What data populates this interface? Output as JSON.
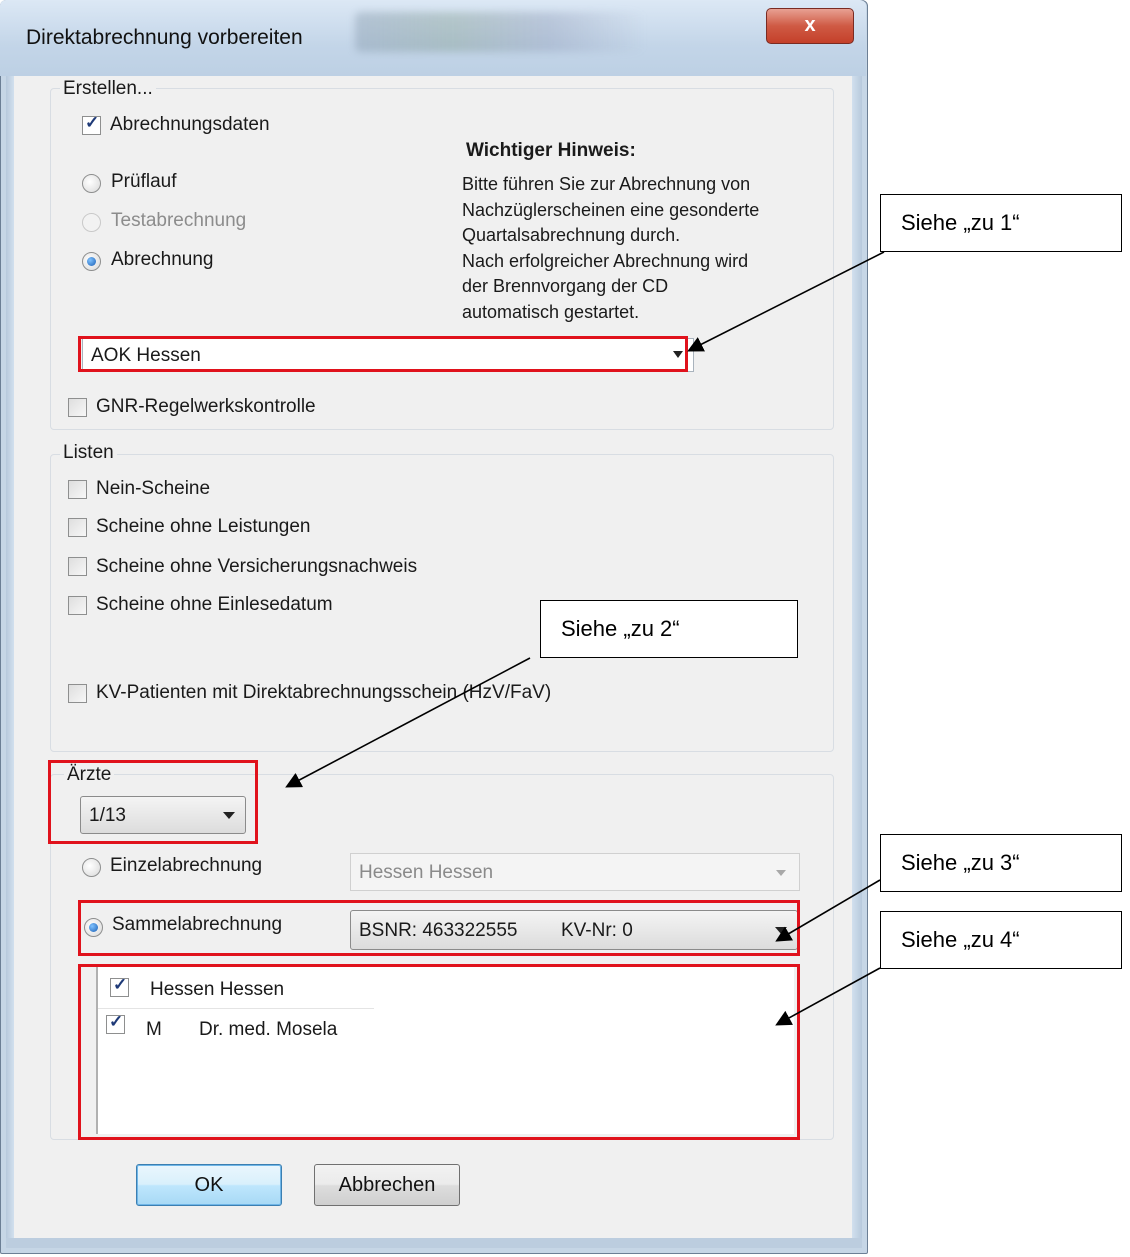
{
  "window": {
    "title": "Direktabrechnung vorbereiten",
    "close_glyph": "x"
  },
  "erstellen": {
    "legend": "Erstellen...",
    "abrechnungsdaten": {
      "label": "Abrechnungsdaten",
      "checked": true
    },
    "radios": [
      {
        "label": "Prüflauf",
        "selected": false,
        "enabled": true
      },
      {
        "label": "Testabrechnung",
        "selected": false,
        "enabled": false
      },
      {
        "label": "Abrechnung",
        "selected": true,
        "enabled": true
      }
    ],
    "hint_title": "Wichtiger Hinweis:",
    "hint_lines": [
      "Bitte führen Sie zur Abrechnung von",
      "Nachzüglerscheinen eine gesonderte",
      "Quartalsabrechnung durch.",
      "Nach erfolgreicher Abrechnung wird",
      "der Brennvorgang der CD",
      "automatisch gestartet."
    ],
    "kasse_select": "AOK Hessen",
    "gnr": {
      "label": "GNR-Regelwerkskontrolle",
      "checked": false
    }
  },
  "listen": {
    "legend": "Listen",
    "items": [
      {
        "label": "Nein-Scheine",
        "checked": false
      },
      {
        "label": "Scheine ohne Leistungen",
        "checked": false
      },
      {
        "label": "Scheine ohne Versicherungsnachweis",
        "checked": false
      },
      {
        "label": "Scheine ohne Einlesedatum",
        "checked": false
      }
    ],
    "kv_patienten": {
      "label": "KV-Patienten mit Direktabrechnungsschein (HzV/FaV)",
      "checked": false
    }
  },
  "aerzte": {
    "legend": "Ärzte",
    "select_value": "1/13",
    "einzel": {
      "label": "Einzelabrechnung",
      "selected": false,
      "combo": "Hessen Hessen"
    },
    "sammel": {
      "label": "Sammelabrechnung",
      "selected": true,
      "bsnr": "BSNR: 463322555",
      "kvnr": "KV-Nr: 0"
    },
    "list_header": {
      "label": "Hessen Hessen",
      "checked": true
    },
    "list_rows": [
      {
        "code": "M",
        "name": "Dr. med. Mosela",
        "checked": true
      }
    ]
  },
  "buttons": {
    "ok": "OK",
    "cancel": "Abbrechen"
  },
  "annotations": {
    "zu1": "Siehe „zu 1“",
    "zu2": "Siehe „zu 2“",
    "zu3": "Siehe „zu 3“",
    "zu4": "Siehe „zu 4“"
  },
  "colors": {
    "highlight": "#e0121c",
    "accent": "#1b5fb5"
  },
  "icons": [
    "checkmark-icon",
    "dropdown-arrow-icon",
    "close-icon",
    "radio-dot-icon"
  ]
}
